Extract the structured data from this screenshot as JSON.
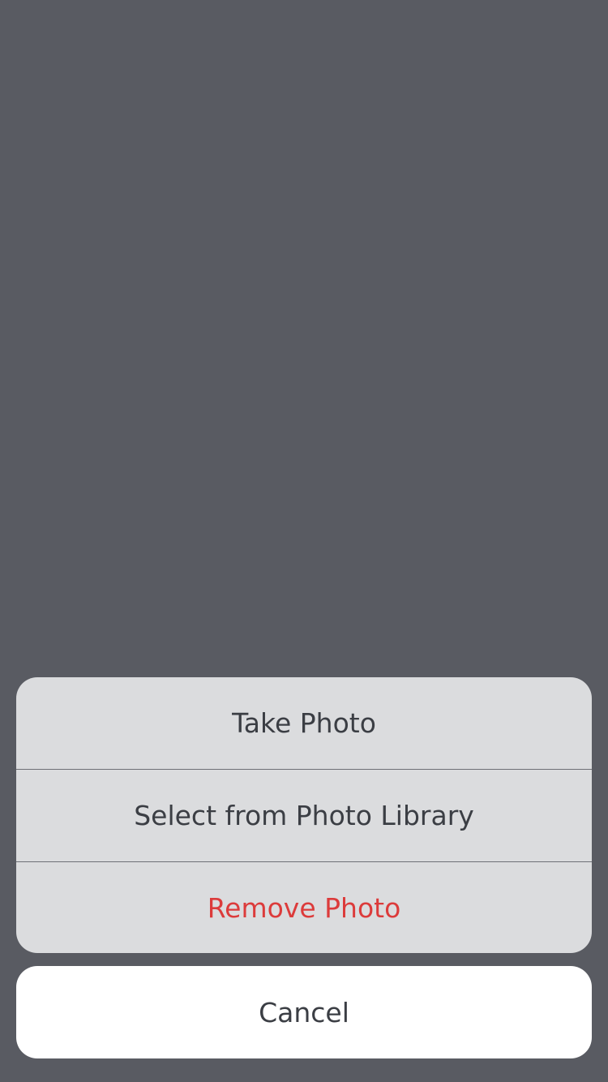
{
  "action_sheet": {
    "take_photo": "Take Photo",
    "select_library": "Select from Photo Library",
    "remove_photo": "Remove Photo",
    "cancel": "Cancel"
  },
  "colors": {
    "overlay": "#595b62",
    "sheet_background": "#dbdcde",
    "cancel_background": "#ffffff",
    "text": "#3b3e44",
    "destructive": "#dc3b3b",
    "separator": "#6e7076"
  }
}
